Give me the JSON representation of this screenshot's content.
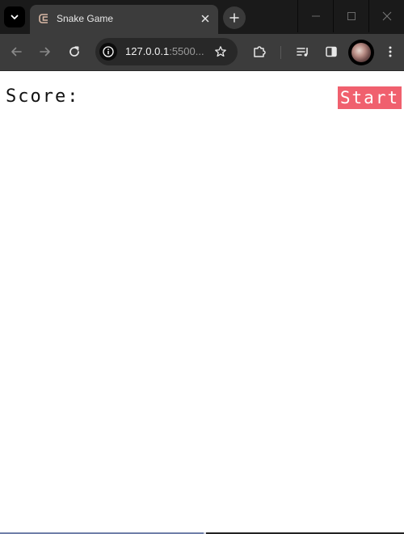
{
  "browser": {
    "tab": {
      "title": "Snake Game"
    },
    "address_bar": {
      "url_host": "127.0.0.1",
      "url_rest": ":5500..."
    },
    "colors": {
      "tab_strip": "#1a1a1a",
      "toolbar": "#3c3c3c"
    }
  },
  "page": {
    "score_label": "Score:",
    "start_button_label": "Start",
    "colors": {
      "start_button_bg": "#f0606e",
      "start_button_text": "#ffffff",
      "background": "#ffffff"
    }
  }
}
